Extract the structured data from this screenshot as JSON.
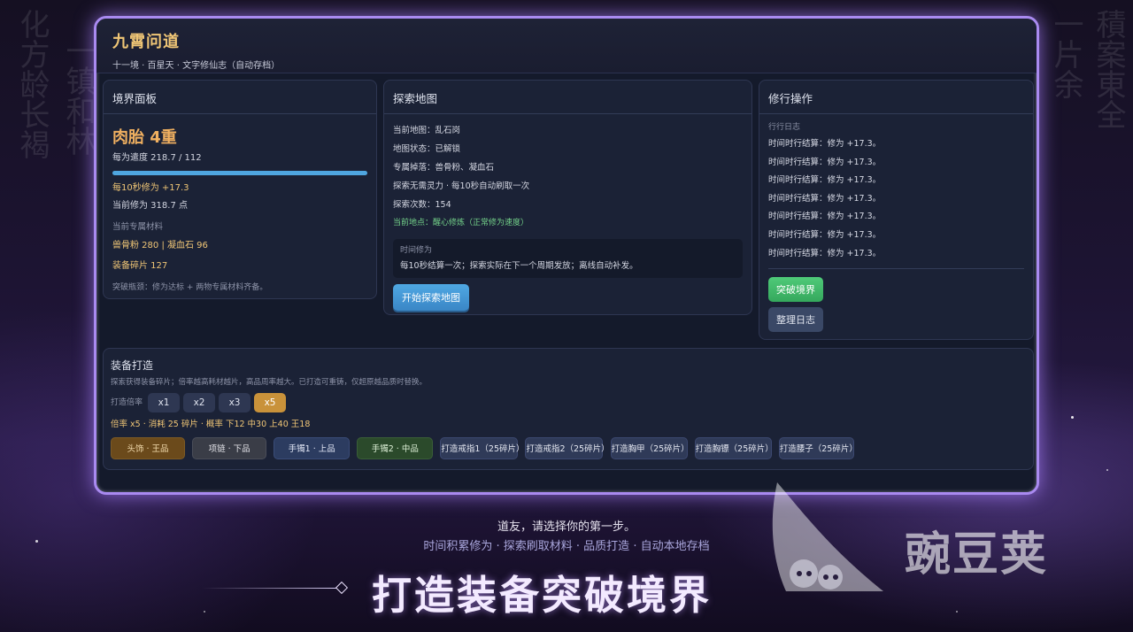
{
  "app": {
    "title": "九霄问道",
    "subtitle": "十一境 · 百星天 · 文字修仙志（自动存档）"
  },
  "realm_panel": {
    "title": "境界面板",
    "realm": "肉胎 4重",
    "cultivation_progress": "每为遣度  218.7 / 112",
    "progress_fraction": 1.0,
    "rate": "每10秒修为 +17.3",
    "current": "当前修为  318.7 点",
    "materials_label": "当前专属材料",
    "materials_line1": "兽骨粉  280   |   凝血石  96",
    "materials_line2": "装备碎片  127",
    "hint": "突破瓶颈：修为达标 + 两物专属材料齐备。"
  },
  "explore_panel": {
    "title": "探索地图",
    "map": "当前地图：乱石岗",
    "status": "地图状态：已解锁",
    "drops": "专属掉落：兽骨粉、凝血石",
    "cost": "探索无需灵力 · 每10秒自动刷取一次",
    "count": "探索次数：154",
    "location": "当前地点：醒心修炼（正常修为速度）",
    "idle_label": "时间修为",
    "idle_text": "每10秒结算一次；探索实际在下一个周期发放；离线自动补发。",
    "start_button": "开始探索地图"
  },
  "practice_panel": {
    "title": "修行操作",
    "log_label": "行行日志",
    "logs": [
      "时间时行结算：修为 +17.3。",
      "时间时行结算：修为 +17.3。",
      "时间时行结算：修为 +17.3。",
      "时间时行结算：修为 +17.3。",
      "时间时行结算：修为 +17.3。",
      "时间时行结算：修为 +17.3。",
      "时间时行结算：修为 +17.3。"
    ],
    "breakthrough_button": "突破境界",
    "organize_button": "整理日志"
  },
  "forge_panel": {
    "title": "装备打造",
    "desc": "探索获得装备碎片；倍率越高耗材越片，高品周率越大。已打造可重铸，仅超原越品质时替换。",
    "multiplier_label": "打造倍率",
    "multipliers": [
      "x1",
      "x2",
      "x3",
      "x5"
    ],
    "active_multiplier": "x5",
    "rate_line": "倍率 x5 · 消耗 25 碎片 · 概率 下12 中30 上40 王18",
    "items": [
      "头饰 · 王品",
      "项链 · 下品",
      "手镯1 · 上品",
      "手镯2 · 中品",
      "打造戒指1（25碎片）",
      "打造戒指2（25碎片）",
      "打造胸甲（25碎片）",
      "打造胸镖（25碎片）",
      "打造腰子（25碎片）"
    ]
  },
  "promo": {
    "line1": "道友，请选择你的第一步。",
    "line2": "时间积累修为 · 探索刷取材料 · 品质打造 · 自动本地存档",
    "headline": "打造装备突破境界"
  },
  "watermark": {
    "text": "豌豆荚"
  },
  "colors": {
    "accent_gold": "#f0c676",
    "accent_blue": "#4fa6e0",
    "window_border": "#a98af0",
    "success_green": "#4fca79"
  }
}
